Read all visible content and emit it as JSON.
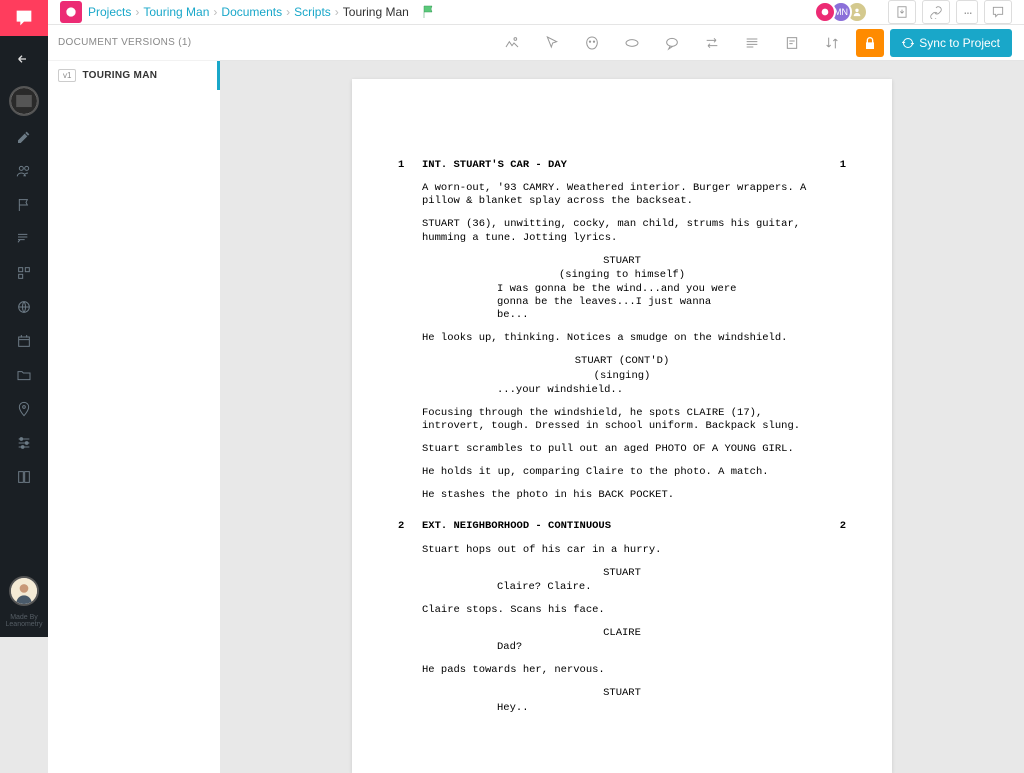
{
  "breadcrumb": {
    "projects": "Projects",
    "project": "Touring Man",
    "documents": "Documents",
    "scripts": "Scripts",
    "current": "Touring Man"
  },
  "users": {
    "u2_initials": "MN"
  },
  "header_btn_ellipsis": "···",
  "versions": {
    "header": "DOCUMENT VERSIONS (1)",
    "items": [
      {
        "badge": "v1",
        "name": "TOURING MAN"
      }
    ]
  },
  "sync_label": "Sync to Project",
  "script": {
    "scenes": [
      {
        "num": "1",
        "heading": "INT. STUART'S CAR - DAY",
        "blocks": [
          {
            "t": "action",
            "text": "A worn-out, '93 CAMRY. Weathered interior. Burger wrappers. A pillow & blanket splay across the backseat."
          },
          {
            "t": "action",
            "text": "STUART (36), unwitting, cocky, man child, strums his guitar, humming a tune. Jotting lyrics."
          },
          {
            "t": "char",
            "text": "STUART"
          },
          {
            "t": "paren",
            "text": "(singing to himself)"
          },
          {
            "t": "dialogue",
            "text": "I was gonna be the wind...and you were gonna be the leaves...I just wanna be..."
          },
          {
            "t": "action",
            "text": "He looks up, thinking. Notices a smudge on the windshield."
          },
          {
            "t": "char",
            "text": "STUART (CONT'D)"
          },
          {
            "t": "paren",
            "text": "(singing)"
          },
          {
            "t": "dialogue",
            "text": "...your windshield.."
          },
          {
            "t": "action",
            "text": "Focusing through the windshield, he spots CLAIRE (17), introvert, tough. Dressed in school uniform. Backpack slung."
          },
          {
            "t": "action",
            "text": "Stuart scrambles to pull out an aged PHOTO OF A YOUNG GIRL."
          },
          {
            "t": "action",
            "text": "He holds it up, comparing Claire to the photo. A match."
          },
          {
            "t": "action",
            "text": "He stashes the photo in his BACK POCKET."
          }
        ]
      },
      {
        "num": "2",
        "heading": "EXT. NEIGHBORHOOD - CONTINUOUS",
        "blocks": [
          {
            "t": "action",
            "text": "Stuart hops out of his car in a hurry."
          },
          {
            "t": "char",
            "text": "STUART"
          },
          {
            "t": "dialogue",
            "text": "Claire? Claire."
          },
          {
            "t": "action",
            "text": "Claire stops. Scans his face."
          },
          {
            "t": "char",
            "text": "CLAIRE"
          },
          {
            "t": "dialogue",
            "text": "Dad?"
          },
          {
            "t": "action",
            "text": "He pads towards her, nervous."
          },
          {
            "t": "char",
            "text": "STUART"
          },
          {
            "t": "dialogue",
            "text": "Hey.."
          }
        ]
      }
    ]
  },
  "footer": {
    "line1": "Made By",
    "line2": "Leanometry"
  }
}
